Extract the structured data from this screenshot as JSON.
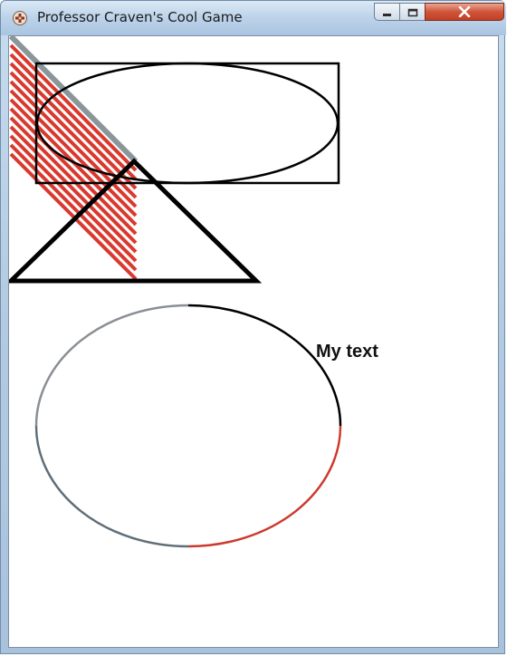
{
  "window": {
    "title": "Professor Craven's Cool Game",
    "app_icon": "game-controller-icon",
    "buttons": {
      "minimize": "minimize-icon",
      "maximize": "maximize-icon",
      "close": "close-icon"
    }
  },
  "canvas": {
    "background": "#ffffff",
    "label": "My text",
    "colors": {
      "hatch": "#d93a2f",
      "diagonal": "#8a9699",
      "outline": "#000000",
      "arc_gray": "#8a8f95",
      "arc_red": "#cc3a2e"
    }
  }
}
